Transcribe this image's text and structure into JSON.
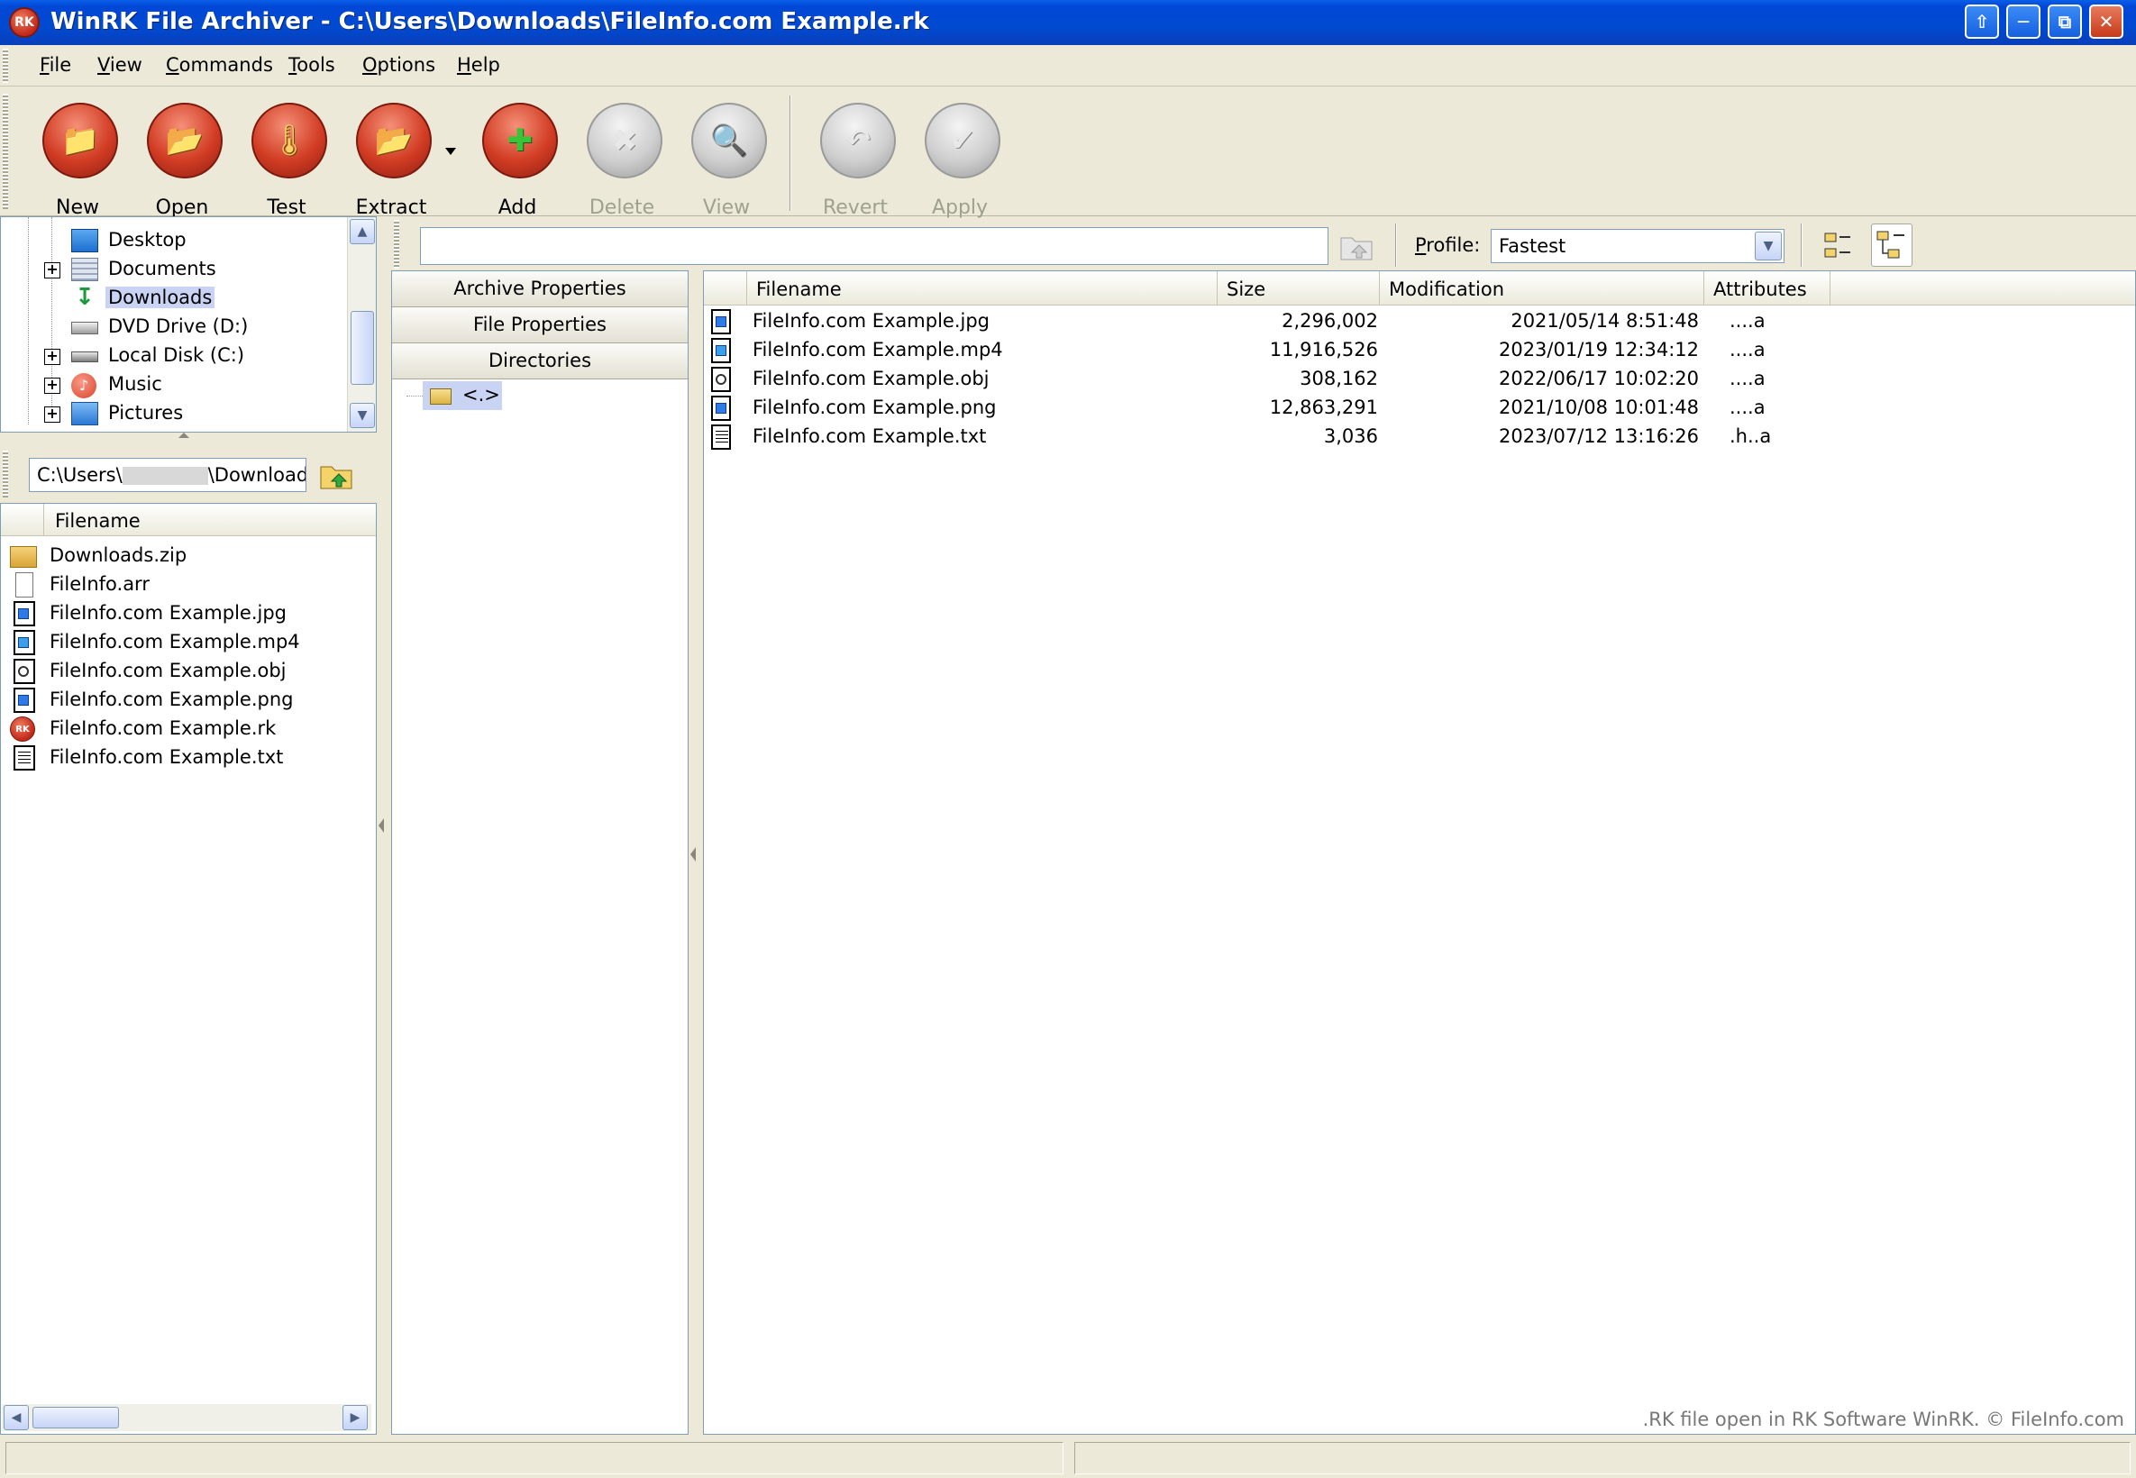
{
  "window": {
    "title": "WinRK File Archiver - C:\\Users\\Downloads\\FileInfo.com Example.rk",
    "app_icon_text": "RK",
    "controls": [
      "restore-up",
      "minimize",
      "restore",
      "close"
    ]
  },
  "menu": [
    {
      "label": "File",
      "accel": "F"
    },
    {
      "label": "View",
      "accel": "V"
    },
    {
      "label": "Commands",
      "accel": "C"
    },
    {
      "label": "Tools",
      "accel": "T"
    },
    {
      "label": "Options",
      "accel": "O"
    },
    {
      "label": "Help",
      "accel": "H"
    }
  ],
  "toolbar": {
    "buttons": [
      {
        "label": "New",
        "icon": "folder-new-icon",
        "enabled": true
      },
      {
        "label": "Open",
        "icon": "folder-open-icon",
        "enabled": true
      },
      {
        "label": "Test",
        "icon": "thermometer-icon",
        "enabled": true
      },
      {
        "label": "Extract",
        "icon": "extract-icon",
        "enabled": true
      },
      {
        "label": "Add",
        "icon": "add-icon",
        "enabled": true
      },
      {
        "label": "Delete",
        "icon": "delete-icon",
        "enabled": false
      },
      {
        "label": "View",
        "icon": "magnifier-icon",
        "enabled": false
      },
      {
        "label": "Revert",
        "icon": "undo-icon",
        "enabled": false
      },
      {
        "label": "Apply",
        "icon": "checkmark-icon",
        "enabled": false
      }
    ]
  },
  "tree": {
    "items": [
      {
        "label": "Desktop",
        "expandable": false,
        "icon": "desktop-icon"
      },
      {
        "label": "Documents",
        "expandable": true,
        "icon": "documents-icon"
      },
      {
        "label": "Downloads",
        "expandable": false,
        "icon": "downloads-icon",
        "selected": true
      },
      {
        "label": "DVD Drive (D:)",
        "expandable": false,
        "icon": "dvd-drive-icon"
      },
      {
        "label": "Local Disk (C:)",
        "expandable": true,
        "icon": "hard-disk-icon"
      },
      {
        "label": "Music",
        "expandable": true,
        "icon": "music-icon"
      },
      {
        "label": "Pictures",
        "expandable": true,
        "icon": "pictures-icon"
      }
    ]
  },
  "path_bar": {
    "prefix": "C:\\Users\\",
    "suffix": "\\Downloads"
  },
  "left_list": {
    "header": "Filename",
    "files": [
      {
        "name": "Downloads.zip",
        "icon": "zip"
      },
      {
        "name": "FileInfo.arr",
        "icon": "blank"
      },
      {
        "name": "FileInfo.com Example.jpg",
        "icon": "image"
      },
      {
        "name": "FileInfo.com Example.mp4",
        "icon": "video"
      },
      {
        "name": "FileInfo.com Example.obj",
        "icon": "obj"
      },
      {
        "name": "FileInfo.com Example.png",
        "icon": "image"
      },
      {
        "name": "FileInfo.com Example.rk",
        "icon": "rk"
      },
      {
        "name": "FileInfo.com Example.txt",
        "icon": "txt"
      }
    ]
  },
  "middle": {
    "tabs": [
      "Archive Properties",
      "File Properties",
      "Directories"
    ],
    "dir_node": "<.>"
  },
  "address": {
    "value": "",
    "profile_label": "Profile:",
    "profile_accel": "P",
    "profile_value": "Fastest"
  },
  "archive": {
    "columns": [
      "Filename",
      "Size",
      "Modification",
      "Attributes"
    ],
    "rows": [
      {
        "name": "FileInfo.com Example.jpg",
        "size": "2,296,002",
        "modified": "2021/05/14 8:51:48",
        "attr": "....a",
        "icon": "image"
      },
      {
        "name": "FileInfo.com Example.mp4",
        "size": "11,916,526",
        "modified": "2023/01/19 12:34:12",
        "attr": "....a",
        "icon": "video"
      },
      {
        "name": "FileInfo.com Example.obj",
        "size": "308,162",
        "modified": "2022/06/17 10:02:20",
        "attr": "....a",
        "icon": "obj"
      },
      {
        "name": "FileInfo.com Example.png",
        "size": "12,863,291",
        "modified": "2021/10/08 10:01:48",
        "attr": "....a",
        "icon": "image"
      },
      {
        "name": "FileInfo.com Example.txt",
        "size": "3,036",
        "modified": "2023/07/12 13:16:26",
        "attr": ".h..a",
        "icon": "txt"
      }
    ],
    "watermark": ".RK file open in RK Software WinRK. © FileInfo.com"
  },
  "status": {
    "left": "",
    "right": ""
  }
}
